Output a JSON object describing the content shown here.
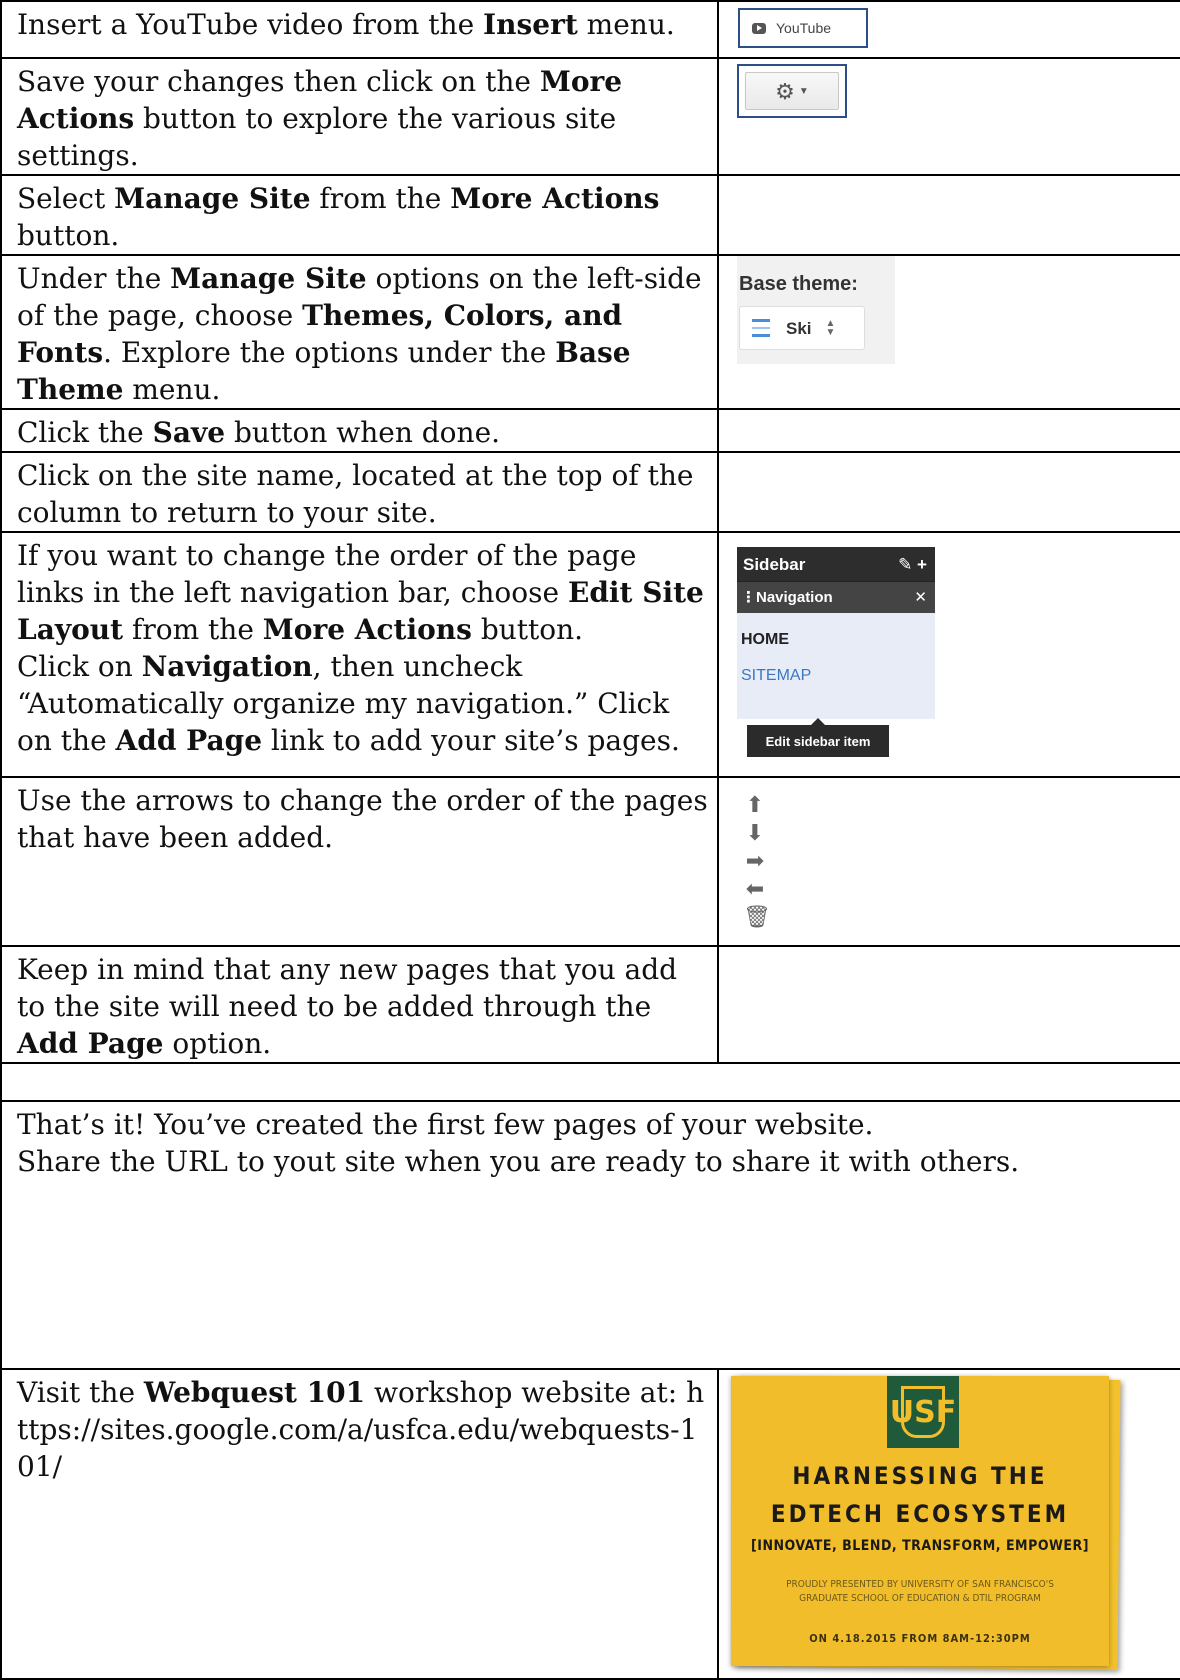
{
  "rows": [
    {
      "text": [
        {
          "t": "Insert a YouTube video from the "
        },
        {
          "t": "Insert",
          "b": true
        },
        {
          "t": " menu."
        }
      ]
    },
    {
      "text": [
        {
          "t": "Save your changes then click on the "
        },
        {
          "t": "More Actions",
          "b": true
        },
        {
          "t": " button to explore the various site settings."
        }
      ]
    },
    {
      "text": [
        {
          "t": "Select "
        },
        {
          "t": "Manage Site",
          "b": true
        },
        {
          "t": " from the "
        },
        {
          "t": "More Actions",
          "b": true
        },
        {
          "t": " button."
        }
      ]
    },
    {
      "text": [
        {
          "t": "Under the "
        },
        {
          "t": "Manage Site",
          "b": true
        },
        {
          "t": " options on the left-side of the page, choose "
        },
        {
          "t": "Themes, Colors, and Fonts",
          "b": true
        },
        {
          "t": ". Explore the options under the "
        },
        {
          "t": "Base Theme",
          "b": true
        },
        {
          "t": " menu."
        }
      ]
    },
    {
      "text": [
        {
          "t": "Click the "
        },
        {
          "t": "Save",
          "b": true
        },
        {
          "t": " button when done."
        }
      ]
    },
    {
      "text": [
        {
          "t": "Click on the site name, located at the top of the column to return to your site."
        }
      ]
    },
    {
      "text": [
        {
          "t": "If you want to change the order of the page links in the left navigation bar, choose "
        },
        {
          "t": "Edit Site Layout",
          "b": true
        },
        {
          "t": " from the "
        },
        {
          "t": "More Actions",
          "b": true
        },
        {
          "t": " button."
        },
        {
          "br": true
        },
        {
          "t": "Click on "
        },
        {
          "t": "Navigation",
          "b": true
        },
        {
          "t": ", then uncheck “Automatically organize my navigation.” Click on the "
        },
        {
          "t": "Add Page",
          "b": true
        },
        {
          "t": " link to add your site’s pages."
        }
      ]
    },
    {
      "text": [
        {
          "t": "Use the arrows to change the order of the pages that have been added."
        }
      ]
    },
    {
      "text": [
        {
          "t": "Keep in mind that any new pages that you add to the site will need to be added through the "
        },
        {
          "t": "Add Page",
          "b": true
        },
        {
          "t": " option."
        }
      ]
    }
  ],
  "final_text": "That’s it! You’ve created the first few pages of your website.",
  "final_text2": "Share the URL to yout site when you are ready to share it with others.",
  "last_row": [
    {
      "t": "Visit the "
    },
    {
      "t": "Webquest 101",
      "b": true
    },
    {
      "t": " workshop website at: https://sites.google.com/a/usfca.edu/webquests-101/"
    }
  ],
  "youtube_label": "YouTube",
  "base_theme_label": "Base theme:",
  "base_theme_value": "Ski",
  "sidebar": {
    "title": "Sidebar",
    "item": "Navigation",
    "links": [
      "HOME",
      "SITEMAP"
    ],
    "tooltip": "Edit sidebar item"
  },
  "poster": {
    "logo": "USF",
    "line1": "HARNESSING THE",
    "line2": "EDTECH ECOSYSTEM",
    "line3": "[INNOVATE, BLEND, TRANSFORM, EMPOWER]",
    "line4": "PROUDLY PRESENTED BY UNIVERSITY OF SAN FRANCISCO'S",
    "line5": "GRADUATE SCHOOL OF EDUCATION & DTIL PROGRAM",
    "line6": "ON 4.18.2015 FROM 8AM-12:30PM"
  }
}
